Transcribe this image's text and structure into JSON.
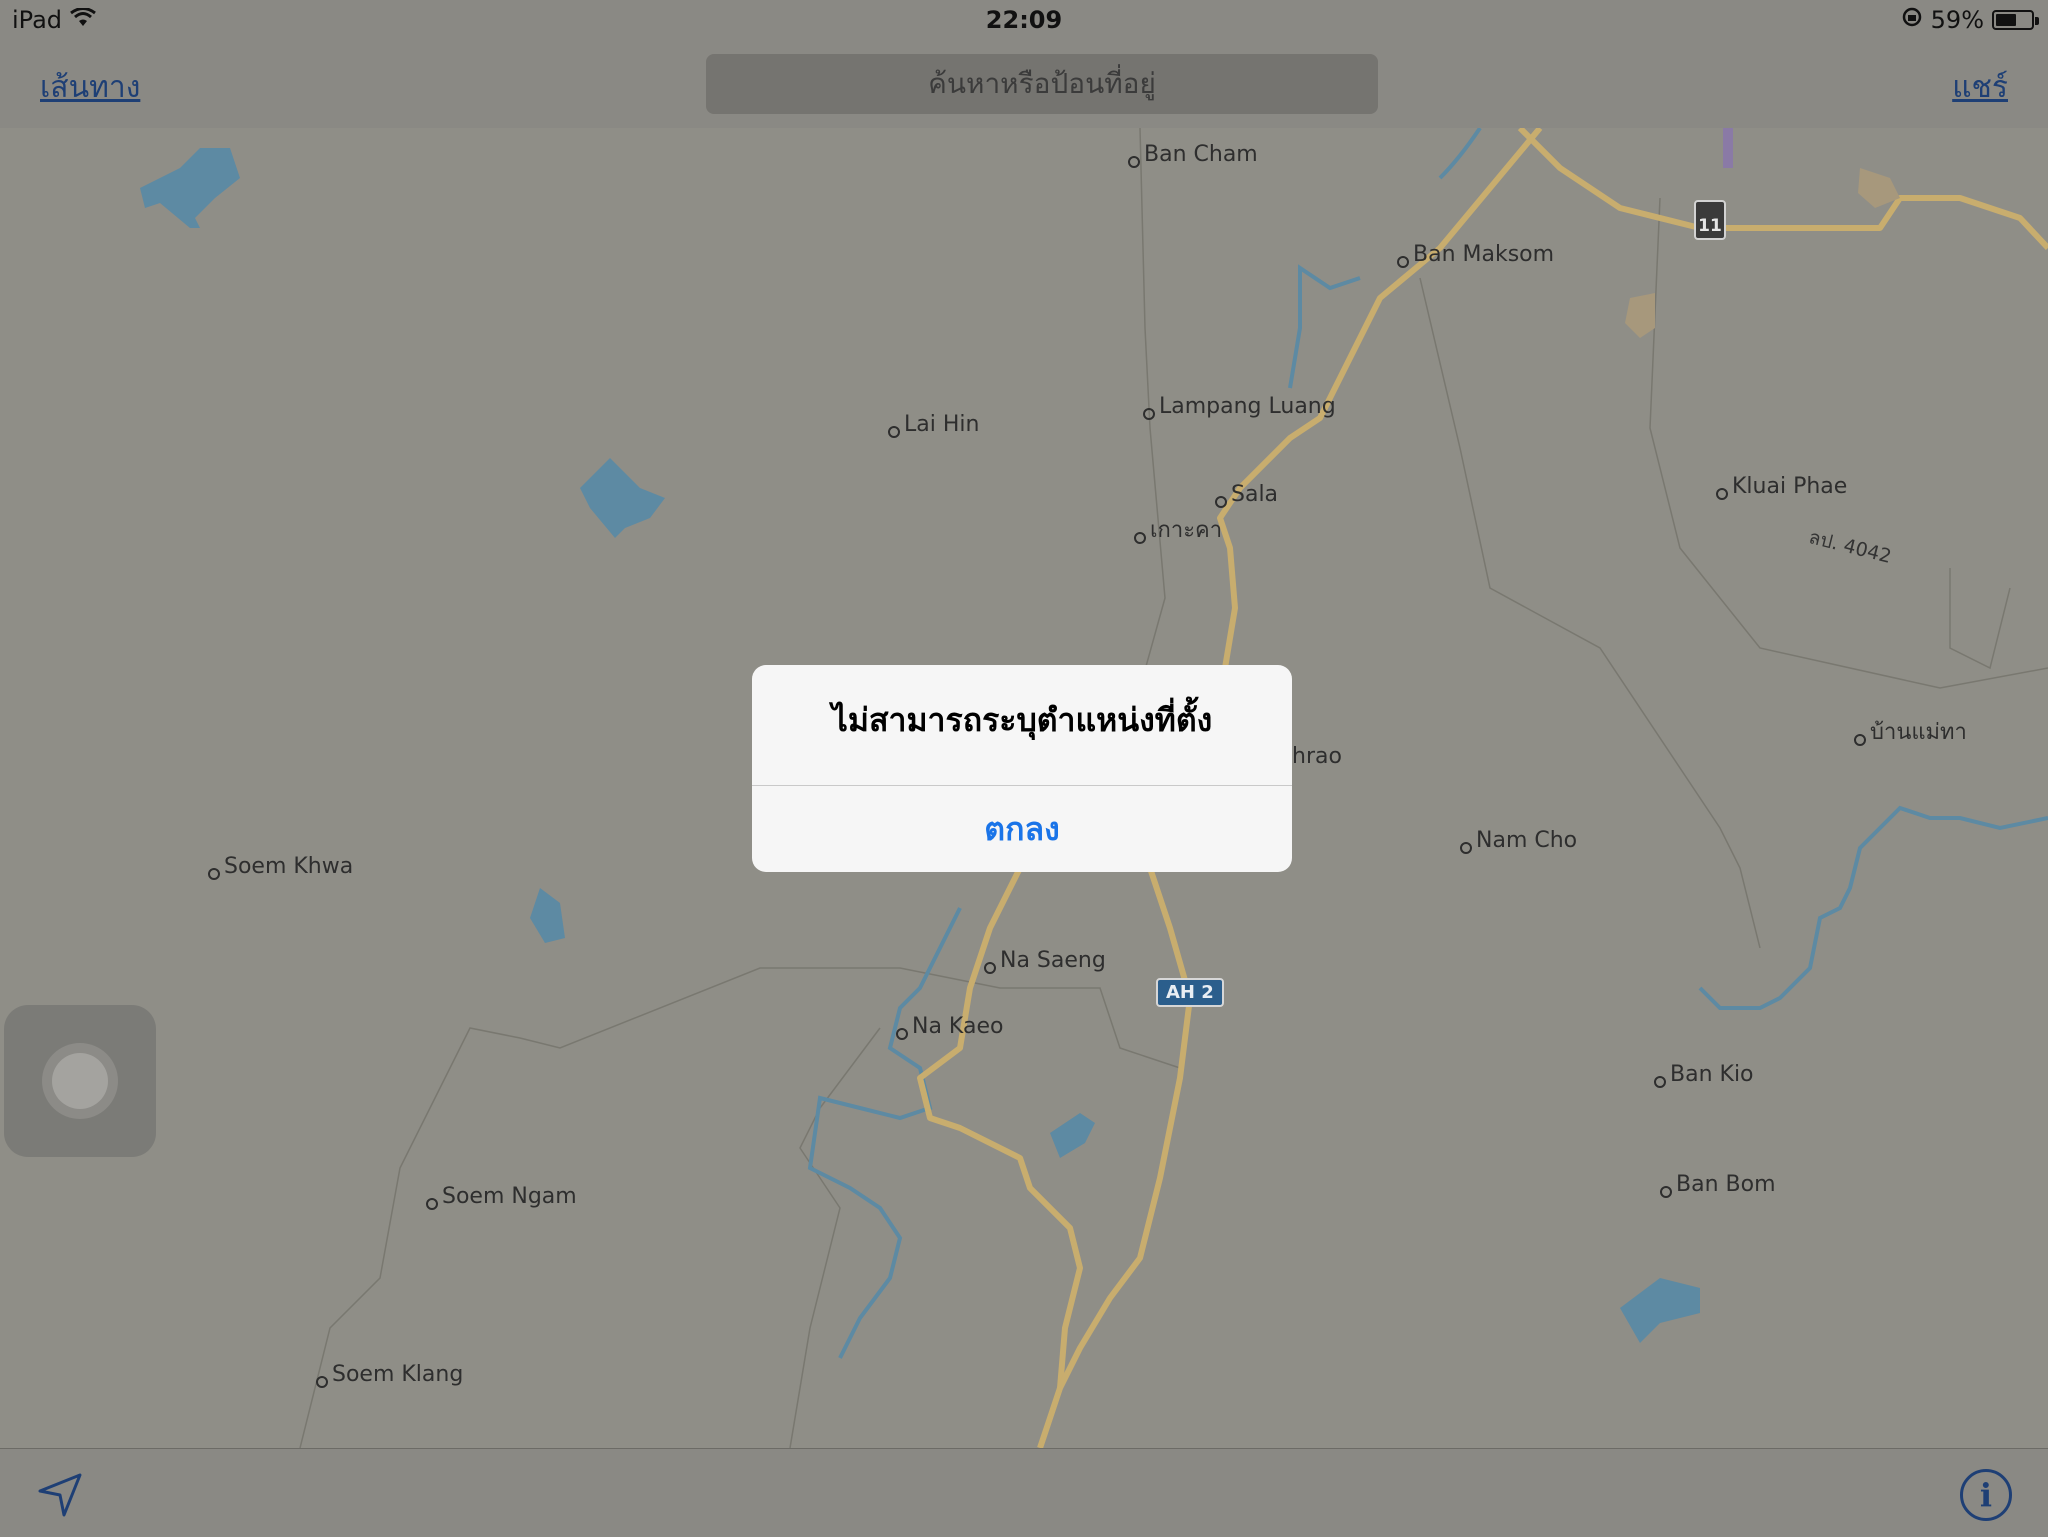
{
  "status_bar": {
    "device": "iPad",
    "time": "22:09",
    "battery_percent": "59%",
    "battery_level": 0.59,
    "icons": [
      "wifi-icon",
      "orientation-lock-icon",
      "battery-icon"
    ]
  },
  "nav": {
    "directions_label": "เส้นทาง",
    "search_placeholder": "ค้นหาหรือป้อนที่อยู่",
    "share_label": "แชร์"
  },
  "map": {
    "places": {
      "ban_cham": "Ban Cham",
      "ban_maksom": "Ban Maksom",
      "lai_hin": "Lai Hin",
      "lampang_luang": "Lampang Luang",
      "sala": "Sala",
      "ko_kha": "เกาะคา",
      "kluai_phae": "Kluai Phae",
      "ban_mae_tha": "บ้านแม่ทา",
      "hrao": "hrao",
      "nam_cho": "Nam Cho",
      "soem_khwa": "Soem Khwa",
      "na_saeng": "Na Saeng",
      "na_kaeo": "Na Kaeo",
      "ban_kio": "Ban Kio",
      "ban_bom": "Ban Bom",
      "soem_ngam": "Soem Ngam",
      "soem_klang": "Soem Klang"
    },
    "route_shield_ah2": "AH 2",
    "route_shield_11": "11",
    "road_label_4042": "ลป. 4042",
    "colors": {
      "land": "#8f8e87",
      "water": "#5d8aa3",
      "road": "#c8ad6e",
      "border": "#7a7972"
    }
  },
  "alert": {
    "title": "ไม่สามารถระบุตำแหน่งที่ตั้ง",
    "ok_label": "ตกลง"
  },
  "toolbar": {
    "icons": [
      "location-arrow-icon",
      "info-icon"
    ],
    "info_glyph": "i"
  }
}
